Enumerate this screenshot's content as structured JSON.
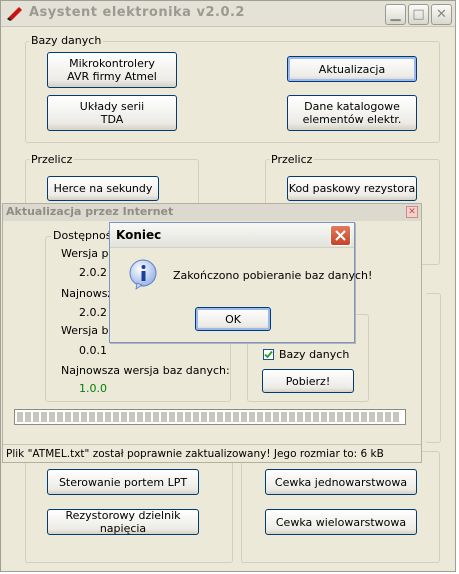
{
  "main": {
    "title": "Asystent elektronika v2.0.2",
    "groups": {
      "bazy": {
        "label": "Bazy danych",
        "avr_button": "Mikrokontrolery\nAVR firmy Atmel",
        "tda_button": "Układy serii\nTDA",
        "update_button": "Aktualizacja",
        "catalog_button": "Dane katalogowe\nelementów elektr."
      },
      "przelicz_left": {
        "label": "Przelicz",
        "hertz_button": "Herce na sekundy"
      },
      "przelicz_right": {
        "label": "Przelicz",
        "resistor_button": "Kod paskowy rezystora"
      },
      "bottom_left": {
        "lpt_button": "Sterowanie portem LPT",
        "divider_button": "Rezystorowy dzielnik napięcia"
      },
      "bottom_right": {
        "single_coil_button": "Cewka jednowarstwowa",
        "multi_coil_button": "Cewka wielowarstwowa"
      }
    }
  },
  "update_window": {
    "title": "Aktualizacja przez Internet",
    "available_label": "Dostępność",
    "program_version_label": "Wersja pr",
    "program_version_value": "2.0.2",
    "newest_program_label": "Najnowsza",
    "newest_program_value": "2.0.2",
    "db_version_label": "Wersja ba",
    "db_version_value": "0.0.1",
    "newest_db_label": "Najnowsza wersja baz danych:",
    "newest_db_value": "1.0.0",
    "newest_db_color": "#008000",
    "db_checkbox_label": "Bazy danych",
    "db_checkbox_checked": true,
    "download_button": "Pobierz!",
    "progress_fraction": 1.0,
    "status": "Plik \"ATMEL.txt\" został poprawnie zaktualizowany! Jego rozmiar to: 6 kB"
  },
  "dialog": {
    "title": "Koniec",
    "message": "Zakończono pobieranie baz danych!",
    "ok_button": "OK"
  }
}
